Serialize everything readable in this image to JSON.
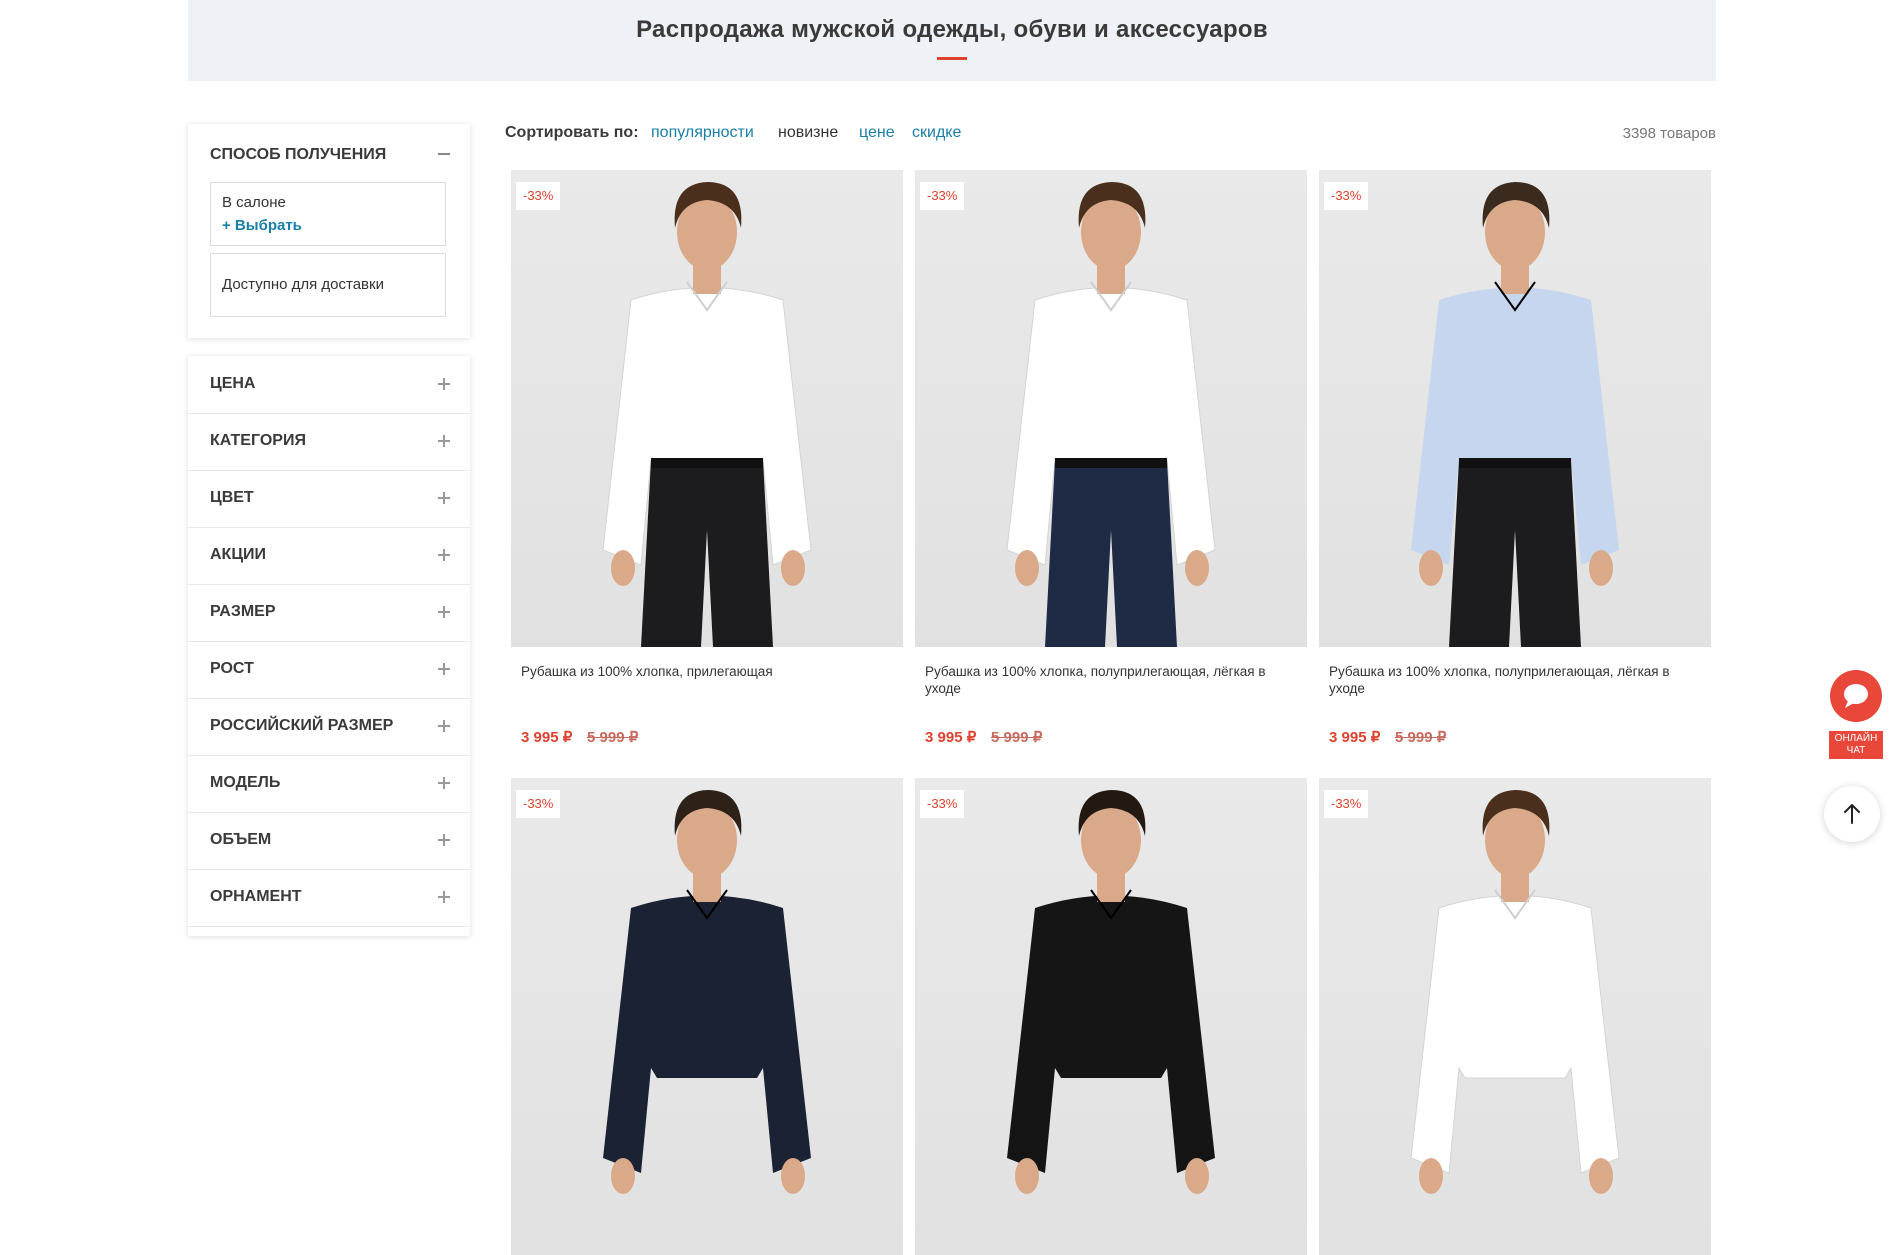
{
  "banner": {
    "title": "Распродажа мужской одежды, обуви и аксессуаров"
  },
  "delivery": {
    "title": "СПОСОБ ПОЛУЧЕНИЯ",
    "option_salon": "В салоне",
    "option_salon_action": "+ Выбрать",
    "option_delivery": "Доступно для доставки"
  },
  "filters": [
    "ЦЕНА",
    "КАТЕГОРИЯ",
    "ЦВЕТ",
    "АКЦИИ",
    "РАЗМЕР",
    "РОСТ",
    "РОССИЙСКИЙ РАЗМЕР",
    "МОДЕЛЬ",
    "ОБЪЕМ",
    "ОРНАМЕНТ"
  ],
  "sort": {
    "label": "Сортировать по:",
    "options": [
      "популярности",
      "новизне",
      "цене",
      "скидке"
    ],
    "count": "3398 товаров"
  },
  "colors": {
    "accent": "#e0412f",
    "link": "#1a7fa8"
  },
  "products": [
    {
      "badge": "-33%",
      "name": "Рубашка из 100% хлопка, прилегающая",
      "price": "3 995 ₽",
      "old_price": "5 999 ₽",
      "shirt": "#ffffff",
      "trousers": "#1c1c1e",
      "hair": "#4a2f1c"
    },
    {
      "badge": "-33%",
      "name": "Рубашка из 100% хлопка, полуприлегающая, лёгкая в уходе",
      "price": "3 995 ₽",
      "old_price": "5 999 ₽",
      "shirt": "#ffffff",
      "trousers": "#1f2a45",
      "hair": "#4a2f1c"
    },
    {
      "badge": "-33%",
      "name": "Рубашка из 100% хлопка, полуприлегающая, лёгкая в уходе",
      "price": "3 995 ₽",
      "old_price": "5 999 ₽",
      "shirt": "#c7d6ef",
      "trousers": "#1c1c1e",
      "hair": "#3b2a1e"
    },
    {
      "badge": "-33%",
      "shirt": "#1b2233",
      "hair": "#2e2118"
    },
    {
      "badge": "-33%",
      "shirt": "#151515",
      "hair": "#221912"
    },
    {
      "badge": "-33%",
      "shirt": "#ffffff",
      "hair": "#4a2f1c"
    }
  ],
  "chat": {
    "label_line1": "ОНЛАЙН",
    "label_line2": "ЧАТ"
  }
}
